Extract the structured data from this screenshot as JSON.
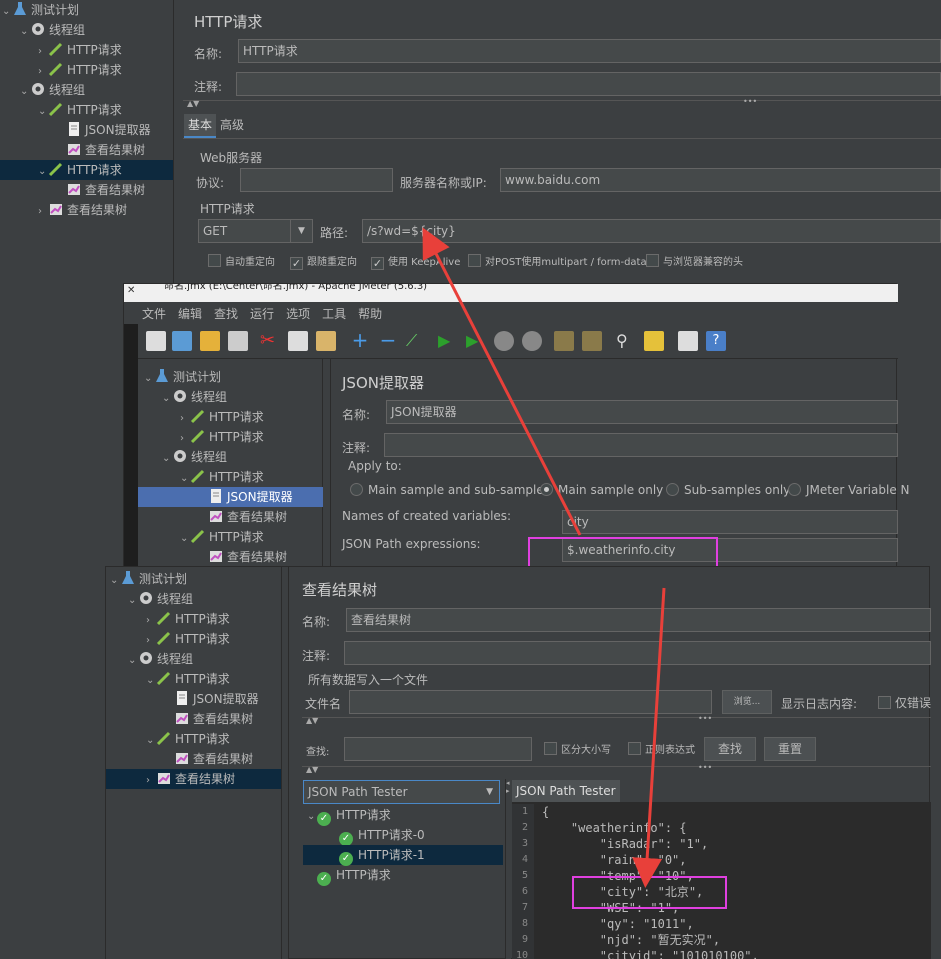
{
  "back": {
    "tree": [
      {
        "label": "测试计划",
        "level": 0,
        "icon": "flask-icon"
      },
      {
        "label": "线程组",
        "level": 1,
        "icon": "gear-icon"
      },
      {
        "label": "HTTP请求",
        "level": 2,
        "icon": "pipette-icon"
      },
      {
        "label": "HTTP请求",
        "level": 2,
        "icon": "pipette-icon"
      },
      {
        "label": "线程组",
        "level": 1,
        "icon": "gear-icon"
      },
      {
        "label": "HTTP请求",
        "level": 2,
        "icon": "pipette-icon"
      },
      {
        "label": "JSON提取器",
        "level": 3,
        "icon": "document-icon"
      },
      {
        "label": "查看结果树",
        "level": 3,
        "icon": "chart-icon"
      },
      {
        "label": "HTTP请求",
        "level": 2,
        "icon": "pipette-icon"
      },
      {
        "label": "查看结果树",
        "level": 3,
        "icon": "chart-icon"
      },
      {
        "label": "查看结果树",
        "level": 2,
        "icon": "chart-icon"
      }
    ],
    "title": "HTTP请求",
    "name_label": "名称:",
    "name_value": "HTTP请求",
    "comment_label": "注释:",
    "tab_basic": "基本",
    "tab_advanced": "高级",
    "web_server": "Web服务器",
    "protocol_label": "协议:",
    "server_label": "服务器名称或IP:",
    "server_value": "www.baidu.com",
    "http_request": "HTTP请求",
    "method": "GET",
    "path_label": "路径:",
    "path_value": "/s?wd=${city}",
    "cb_redirect": "自动重定向",
    "cb_follow": "跟随重定向",
    "cb_keepalive": "使用 KeepAlive",
    "cb_multipart": "对POST使用multipart / form-data",
    "cb_browser": "与浏览器兼容的头"
  },
  "mid": {
    "window_title": "命名.jmx (E:\\Center\\命名.jmx) - Apache JMeter (5.6.3)",
    "menu": [
      "文件",
      "编辑",
      "查找",
      "运行",
      "选项",
      "工具",
      "帮助"
    ],
    "tree": [
      {
        "label": "测试计划",
        "level": 0,
        "icon": "flask-icon"
      },
      {
        "label": "线程组",
        "level": 1,
        "icon": "gear-icon"
      },
      {
        "label": "HTTP请求",
        "level": 2,
        "icon": "pipette-icon"
      },
      {
        "label": "HTTP请求",
        "level": 2,
        "icon": "pipette-icon"
      },
      {
        "label": "线程组",
        "level": 1,
        "icon": "gear-icon"
      },
      {
        "label": "HTTP请求",
        "level": 2,
        "icon": "pipette-icon"
      },
      {
        "label": "JSON提取器",
        "level": 3,
        "icon": "document-icon"
      },
      {
        "label": "查看结果树",
        "level": 3,
        "icon": "chart-icon"
      },
      {
        "label": "HTTP请求",
        "level": 2,
        "icon": "pipette-icon"
      },
      {
        "label": "查看结果树",
        "level": 3,
        "icon": "chart-icon"
      }
    ],
    "title": "JSON提取器",
    "name_label": "名称:",
    "name_value": "JSON提取器",
    "comment_label": "注释:",
    "apply_to": "Apply to:",
    "radio_main_sub": "Main sample and sub-samples",
    "radio_main_only": "Main sample only",
    "radio_sub_only": "Sub-samples only",
    "radio_jmeter_var": "JMeter Variable N",
    "created_vars_label": "Names of created variables:",
    "created_vars_value": "city",
    "json_path_label": "JSON Path expressions:",
    "json_path_value": "$.weatherinfo.city"
  },
  "front": {
    "tree": [
      {
        "label": "测试计划",
        "level": 0,
        "icon": "flask-icon"
      },
      {
        "label": "线程组",
        "level": 1,
        "icon": "gear-icon"
      },
      {
        "label": "HTTP请求",
        "level": 2,
        "icon": "pipette-icon"
      },
      {
        "label": "HTTP请求",
        "level": 2,
        "icon": "pipette-icon"
      },
      {
        "label": "线程组",
        "level": 1,
        "icon": "gear-icon"
      },
      {
        "label": "HTTP请求",
        "level": 2,
        "icon": "pipette-icon"
      },
      {
        "label": "JSON提取器",
        "level": 3,
        "icon": "document-icon"
      },
      {
        "label": "查看结果树",
        "level": 3,
        "icon": "chart-icon"
      },
      {
        "label": "HTTP请求",
        "level": 2,
        "icon": "pipette-icon"
      },
      {
        "label": "查看结果树",
        "level": 3,
        "icon": "chart-icon"
      },
      {
        "label": "查看结果树",
        "level": 2,
        "icon": "chart-icon"
      }
    ],
    "title": "查看结果树",
    "name_label": "名称:",
    "name_value": "查看结果树",
    "comment_label": "注释:",
    "write_all": "所有数据写入一个文件",
    "filename_label": "文件名",
    "browse": "浏览...",
    "log_label": "显示日志内容:",
    "errors_only": "仅错误",
    "search_label": "查找:",
    "case_sensitive": "区分大小写",
    "regex": "正则表达式",
    "find_btn": "查找",
    "reset_btn": "重置",
    "renderer": "JSON Path Tester",
    "result_tab": "JSON Path Tester",
    "results": [
      {
        "label": "HTTP请求",
        "level": 0
      },
      {
        "label": "HTTP请求-0",
        "level": 1
      },
      {
        "label": "HTTP请求-1",
        "level": 1
      },
      {
        "label": "HTTP请求",
        "level": 0
      }
    ],
    "code_lines": [
      "{",
      "    \"weatherinfo\": {",
      "        \"isRadar\": \"1\",",
      "        \"rain\": \"0\",",
      "        \"temp\": \"10\",",
      "        \"city\": \"北京\",",
      "        \"WSE\": \"1\",",
      "        \"qy\": \"1011\",",
      "        \"njd\": \"暂无实况\",",
      "        \"cityid\": \"101010100\","
    ],
    "line_numbers": [
      "1",
      "2",
      "3",
      "4",
      "5",
      "6",
      "7",
      "8",
      "9",
      "10"
    ]
  },
  "colors": {
    "bg": "#3c3f41",
    "field": "#45494a",
    "selection": "#0d293e",
    "selection_mid": "#4b6eaf",
    "highlight_box": "#e040e0",
    "annotation_arrow": "#e8403a",
    "check_green": "#4caf50"
  }
}
